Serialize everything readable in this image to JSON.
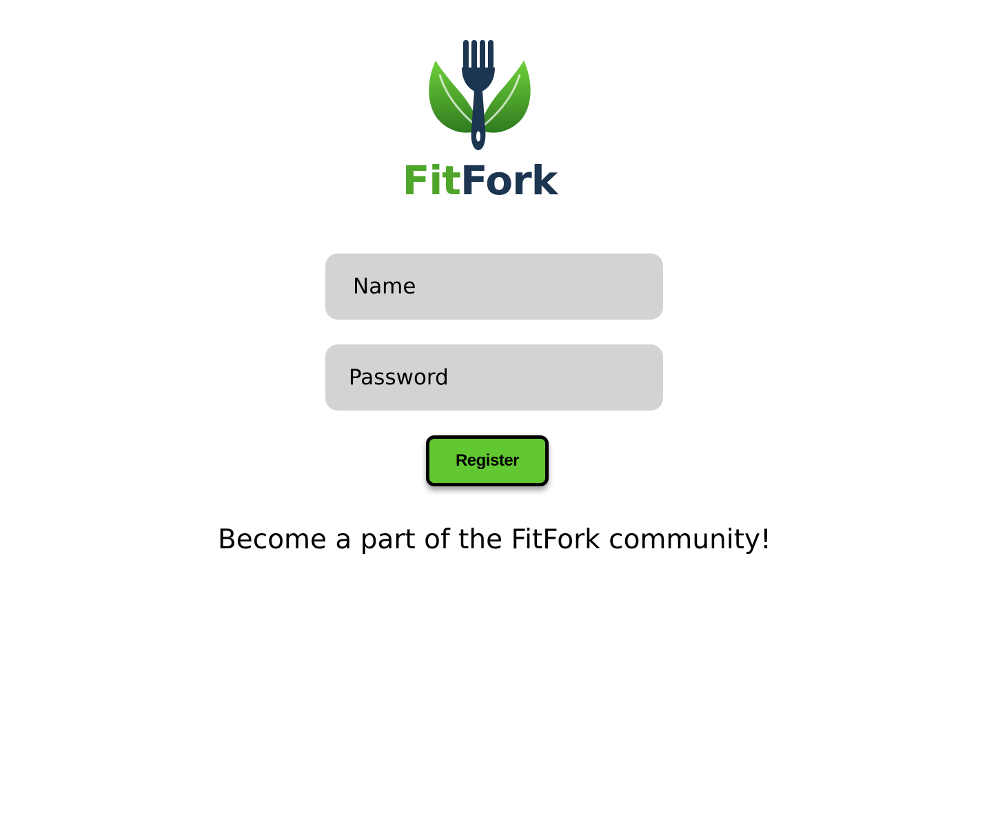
{
  "brand": {
    "name_part1": "Fit",
    "name_part2": "Fork",
    "logo_icon": "fork-with-leaves-icon"
  },
  "form": {
    "name_placeholder": "Name",
    "password_placeholder": "Password",
    "register_label": "Register"
  },
  "tagline": "Become a part of the FitFork community!",
  "colors": {
    "accent": "#62c832",
    "brand_green": "#4ea52a",
    "brand_navy": "#1c3550",
    "field_bg": "#d3d3d3"
  }
}
